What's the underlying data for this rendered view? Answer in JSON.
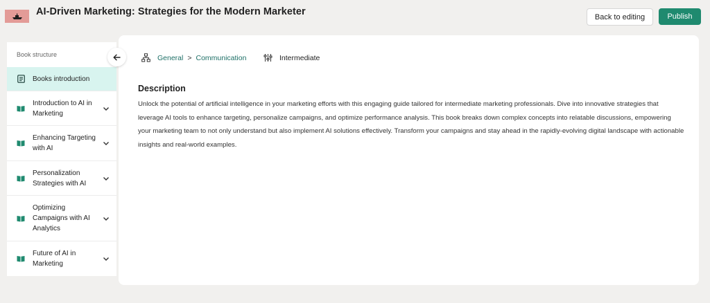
{
  "header": {
    "title": "AI-Driven Marketing: Strategies for the Modern Marketer",
    "back_label": "Back to editing",
    "publish_label": "Publish"
  },
  "sidebar": {
    "heading": "Book structure",
    "items": [
      {
        "label": "Books introduction",
        "icon": "document-icon",
        "active": true
      },
      {
        "label": "Introduction to AI in Marketing",
        "icon": "book-icon"
      },
      {
        "label": "Enhancing Targeting with AI",
        "icon": "book-icon"
      },
      {
        "label": "Personalization Strategies with AI",
        "icon": "book-icon"
      },
      {
        "label": "Optimizing Campaigns with AI Analytics",
        "icon": "book-icon"
      },
      {
        "label": "Future of AI in Marketing",
        "icon": "book-icon"
      }
    ]
  },
  "main": {
    "breadcrumb": {
      "category": "General",
      "separator": ">",
      "subcategory": "Communication"
    },
    "level": "Intermediate",
    "description_title": "Description",
    "description": "Unlock the potential of artificial intelligence in your marketing efforts with this engaging guide tailored for intermediate marketing professionals. Dive into innovative strategies that leverage AI tools to enhance targeting, personalize campaigns, and optimize performance analysis. This book breaks down complex concepts into relatable discussions, empowering your marketing team to not only understand but also implement AI solutions effectively. Transform your campaigns and stay ahead in the rapidly-evolving digital landscape with actionable insights and real-world examples."
  },
  "colors": {
    "accent": "#1f8a6f",
    "active_item_bg": "#d8f4ef",
    "link": "#1d6f66",
    "thumbnail": "#e39b97"
  }
}
